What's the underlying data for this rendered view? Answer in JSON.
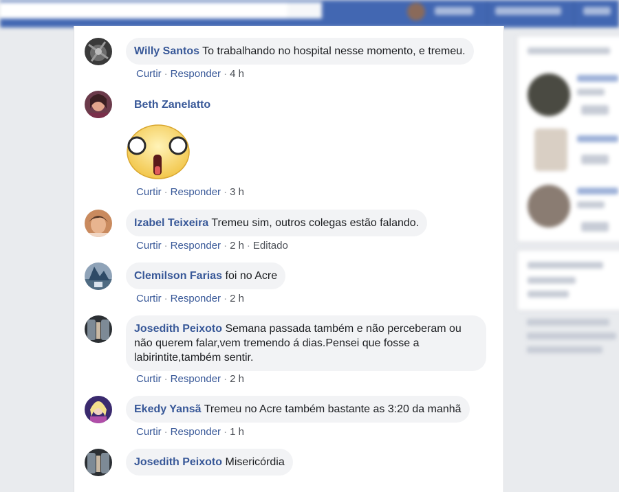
{
  "actions": {
    "like": "Curtir",
    "reply": "Responder",
    "separator": "·"
  },
  "comments": [
    {
      "author": "Willy Santos",
      "text": "To trabalhando no hospital nesse momento, e tremeu.",
      "time": "4 h",
      "avatar_icon": "avatar-photo"
    },
    {
      "author": "Beth Zanelatto",
      "text": "",
      "sticker": "shocked-face-sticker",
      "time": "3 h",
      "avatar_icon": "avatar-photo"
    },
    {
      "author": "Izabel Teixeira",
      "text": "Tremeu sim, outros colegas estão falando.",
      "time": "2 h",
      "edited": "Editado",
      "avatar_icon": "avatar-photo"
    },
    {
      "author": "Clemilson Farias",
      "text": "foi no Acre",
      "time": "2 h",
      "avatar_icon": "avatar-photo"
    },
    {
      "author": "Josedith Peixoto",
      "text": "Semana passada também e não perceberam ou não querem falar,vem tremendo á dias.Pensei que fosse a labirintite,também sentir.",
      "time": "2 h",
      "avatar_icon": "avatar-photo"
    },
    {
      "author": "Ekedy Yansã",
      "text": "Tremeu no Acre também bastante as 3:20 da manhã",
      "time": "1 h",
      "avatar_icon": "avatar-photo"
    },
    {
      "author": "Josedith Peixoto",
      "text": "Misericórdia",
      "avatar_icon": "avatar-photo"
    }
  ],
  "colors": {
    "link": "#385898",
    "bubble": "#f2f3f5",
    "topbar": "#4267b2",
    "page_bg": "#e9ebee"
  }
}
